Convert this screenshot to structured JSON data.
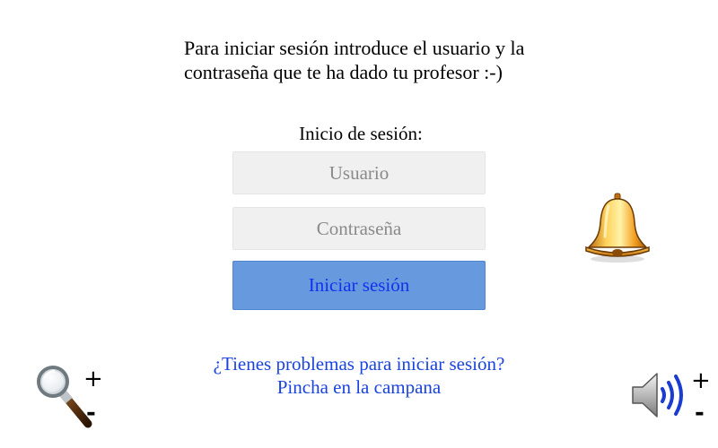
{
  "intro": {
    "line1": "Para iniciar sesión introduce el usuario y la",
    "line2": "contraseña que te ha dado tu profesor :-)"
  },
  "login": {
    "title": "Inicio de sesión:",
    "username_placeholder": "Usuario",
    "username_value": "",
    "password_placeholder": "Contraseña",
    "password_value": "",
    "submit_label": "Iniciar sesión"
  },
  "help": {
    "line1": "¿Tienes problemas para iniciar sesión?",
    "line2": "Pincha en la campana"
  },
  "controls": {
    "zoom_icon": "magnifier-icon",
    "zoom_in_label": "+",
    "zoom_out_label": "-",
    "volume_icon": "speaker-icon",
    "volume_up_label": "+",
    "volume_down_label": "-",
    "help_icon": "bell-icon"
  },
  "colors": {
    "button_bg": "#6699dd",
    "button_text": "#1133ee",
    "help_text": "#1a44dd",
    "field_bg": "#f0f0f0",
    "placeholder_text": "#8a8a8a"
  }
}
